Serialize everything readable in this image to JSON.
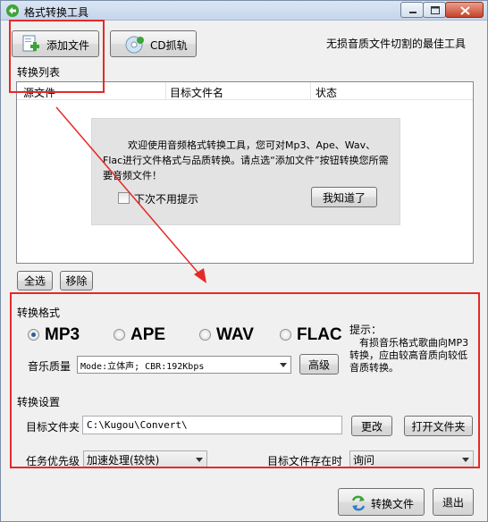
{
  "window": {
    "title": "格式转换工具"
  },
  "toolbar": {
    "add_file_label": "添加文件",
    "cd_rip_label": "CD抓轨",
    "slogan": "无损音质文件切割的最佳工具"
  },
  "file_list": {
    "section_title": "转换列表",
    "columns": [
      "源文件",
      "目标文件名",
      "状态"
    ],
    "rows": []
  },
  "welcome_dialog": {
    "text": "欢迎使用音频格式转换工具，您可对Mp3、Ape、Wav、Flac进行文件格式与品质转换。请点选“添加文件”按钮转换您所需要音频文件！",
    "dont_show_label": "下次不用提示",
    "dont_show_checked": false,
    "ok_label": "我知道了"
  },
  "list_actions": {
    "select_all_label": "全选",
    "remove_label": "移除"
  },
  "format": {
    "section_title": "转换格式",
    "options": [
      "MP3",
      "APE",
      "WAV",
      "FLAC"
    ],
    "selected": "MP3",
    "quality_label": "音乐质量",
    "quality_value": "Mode:立体声; CBR:192Kbps",
    "advanced_label": "高级",
    "tip_title": "提示：",
    "tip_text": "有损音乐格式歌曲向MP3转换，应由较高音质向较低音质转换。"
  },
  "settings": {
    "section_title": "转换设置",
    "target_folder_label": "目标文件夹",
    "target_folder_value": "C:\\Kugou\\Convert\\",
    "change_label": "更改",
    "open_folder_label": "打开文件夹",
    "priority_label": "任务优先级",
    "priority_value": "加速处理(较快)",
    "exists_label": "目标文件存在时",
    "exists_value": "询问"
  },
  "footer": {
    "convert_label": "转换文件",
    "exit_label": "退出"
  },
  "colors": {
    "annotation_red": "#e52929",
    "window_bg": "#f0f0f0"
  }
}
